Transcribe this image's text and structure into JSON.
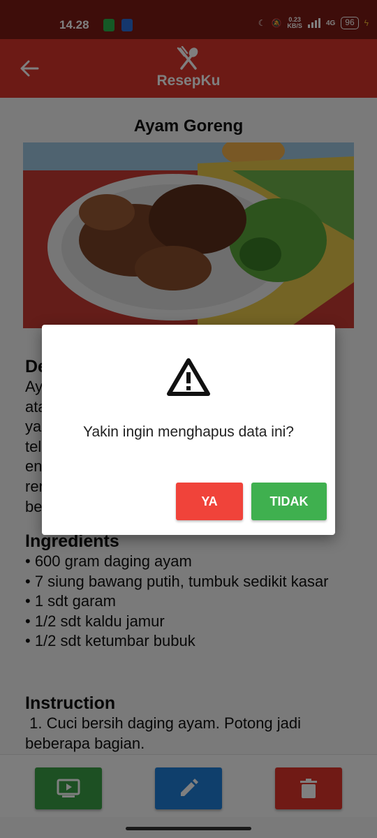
{
  "status_bar": {
    "time": "14.28",
    "speed_value": "0.23",
    "speed_unit": "KB/S",
    "network": "4G",
    "battery": "96"
  },
  "app_bar": {
    "title": "ResepKu",
    "back_icon": "arrow-left-icon",
    "logo_icon": "fork-spoon-icon"
  },
  "recipe": {
    "title": "Ayam Goreng",
    "description_heading": "De",
    "description_fragments": [
      "Ay",
      "ata",
      "ya",
      "tel",
      "en",
      "rer",
      "be"
    ],
    "ingredients_heading": "Ingredients",
    "ingredients": [
      "• 600 gram daging ayam",
      "• 7 siung bawang putih, tumbuk sedikit kasar",
      "• 1 sdt garam",
      "• 1/2 sdt kaldu jamur",
      "• 1/2 sdt ketumbar bubuk"
    ],
    "instruction_heading": "Instruction",
    "instruction_text": " 1. Cuci bersih daging ayam. Potong jadi beberapa bagian."
  },
  "bottom_bar": {
    "buttons": [
      {
        "icon": "tv-play-icon"
      },
      {
        "icon": "pencil-icon"
      },
      {
        "icon": "trash-icon"
      }
    ]
  },
  "dialog": {
    "icon": "warning-triangle-icon",
    "message": "Yakin ingin menghapus data ini?",
    "confirm_label": "YA",
    "cancel_label": "TIDAK"
  },
  "colors": {
    "app_bar": "#d8342a",
    "status_bar": "#7d1a14",
    "confirm": "#f0433a",
    "cancel": "#3fb04f",
    "play": "#3aa047",
    "edit": "#1e7fd8",
    "delete": "#e0352b"
  }
}
